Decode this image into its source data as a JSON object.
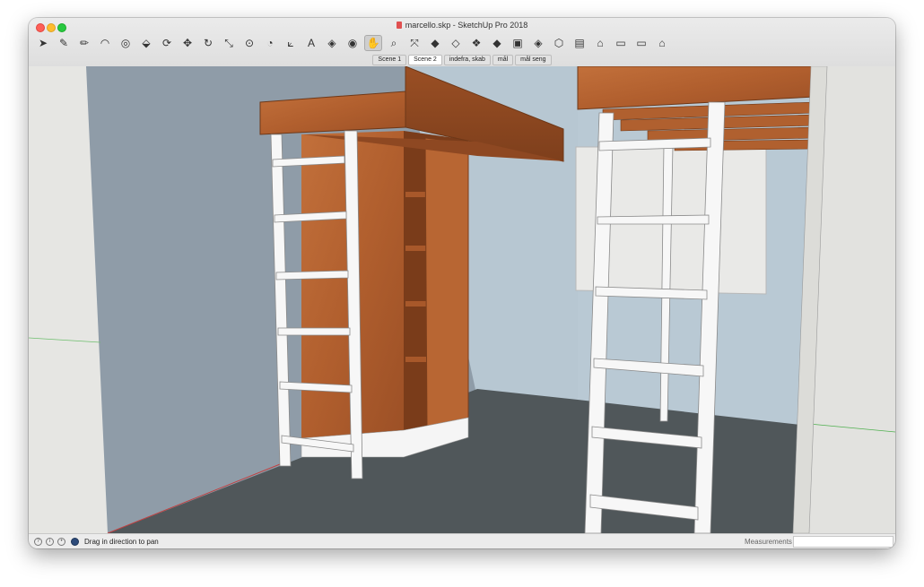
{
  "window": {
    "title": "marcello.skp - SketchUp Pro 2018"
  },
  "toolbar": {
    "tools": [
      {
        "name": "select-tool",
        "icon": "arrow-icon",
        "glyph": "➤"
      },
      {
        "name": "eraser-tool",
        "icon": "eraser-icon",
        "glyph": "✎"
      },
      {
        "name": "line-tool",
        "icon": "pencil-icon",
        "glyph": "✏"
      },
      {
        "name": "arc-tool",
        "icon": "arc-icon",
        "glyph": "◠"
      },
      {
        "name": "shape-tool",
        "icon": "circle-icon",
        "glyph": "◎"
      },
      {
        "name": "pushpull-tool",
        "icon": "pushpull-icon",
        "glyph": "⬙"
      },
      {
        "name": "offset-tool",
        "icon": "offset-icon",
        "glyph": "⟳"
      },
      {
        "name": "move-tool",
        "icon": "move-icon",
        "glyph": "✥"
      },
      {
        "name": "rotate-tool",
        "icon": "rotate-icon",
        "glyph": "↻"
      },
      {
        "name": "scale-tool",
        "icon": "scale-icon",
        "glyph": "⤡"
      },
      {
        "name": "tape-tool",
        "icon": "tape-measure-icon",
        "glyph": "⊙"
      },
      {
        "name": "protractor-tool",
        "icon": "protractor-icon",
        "glyph": "◔"
      },
      {
        "name": "axes-tool",
        "icon": "axes-icon",
        "glyph": "⟀"
      },
      {
        "name": "text-tool",
        "icon": "text-icon",
        "glyph": "A"
      },
      {
        "name": "paint-tool",
        "icon": "paint-bucket-icon",
        "glyph": "◈"
      },
      {
        "name": "orbit-tool",
        "icon": "orbit-icon",
        "glyph": "◉"
      },
      {
        "name": "pan-tool",
        "icon": "hand-icon",
        "glyph": "✋"
      },
      {
        "name": "zoom-tool",
        "icon": "magnifier-icon",
        "glyph": "⌕"
      },
      {
        "name": "zoom-extents-tool",
        "icon": "zoom-extents-icon",
        "glyph": "⤧"
      },
      {
        "name": "3dwarehouse-tool",
        "icon": "warehouse-icon",
        "glyph": "◆"
      },
      {
        "name": "extension-tool",
        "icon": "extension-icon",
        "glyph": "◇"
      },
      {
        "name": "component-tool",
        "icon": "component-icon",
        "glyph": "❖"
      },
      {
        "name": "ruby-tool",
        "icon": "ruby-icon",
        "glyph": "◆"
      },
      {
        "name": "layout-tool",
        "icon": "layout-icon",
        "glyph": "▣"
      },
      {
        "name": "style-tool",
        "icon": "style-icon",
        "glyph": "◈"
      },
      {
        "name": "iso-view",
        "icon": "iso-icon",
        "glyph": "⬡"
      },
      {
        "name": "top-view",
        "icon": "top-view-icon",
        "glyph": "▤"
      },
      {
        "name": "front-view",
        "icon": "front-view-icon",
        "glyph": "⌂"
      },
      {
        "name": "right-view",
        "icon": "right-view-icon",
        "glyph": "▭"
      },
      {
        "name": "back-view",
        "icon": "back-view-icon",
        "glyph": "▭"
      },
      {
        "name": "left-view",
        "icon": "left-view-icon",
        "glyph": "⌂"
      }
    ],
    "active_index": 16
  },
  "scenes": [
    "Scene 1",
    "Scene 2",
    "indefra, skab",
    "mål",
    "mål seng"
  ],
  "selected_scene": 1,
  "status": {
    "hint": "Drag in direction to pan",
    "measurements_label": "Measurements",
    "measurements_value": ""
  },
  "colors": {
    "wood": "#b5622f",
    "wall_blue": "#8c9aa7",
    "floor": "#52585b",
    "ladder": "#f7f7f7"
  }
}
